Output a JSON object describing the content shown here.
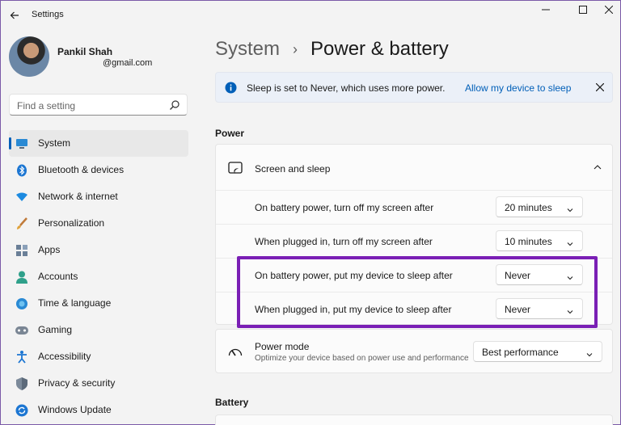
{
  "window": {
    "title": "Settings"
  },
  "user": {
    "name": "Pankil Shah",
    "email": "@gmail.com"
  },
  "search": {
    "placeholder": "Find a setting"
  },
  "sidebar": {
    "items": [
      {
        "label": "System",
        "icon": "monitor-icon"
      },
      {
        "label": "Bluetooth & devices",
        "icon": "bluetooth-icon"
      },
      {
        "label": "Network & internet",
        "icon": "wifi-icon"
      },
      {
        "label": "Personalization",
        "icon": "brush-icon"
      },
      {
        "label": "Apps",
        "icon": "apps-icon"
      },
      {
        "label": "Accounts",
        "icon": "person-icon"
      },
      {
        "label": "Time & language",
        "icon": "globe-clock-icon"
      },
      {
        "label": "Gaming",
        "icon": "gamepad-icon"
      },
      {
        "label": "Accessibility",
        "icon": "accessibility-icon"
      },
      {
        "label": "Privacy & security",
        "icon": "shield-icon"
      },
      {
        "label": "Windows Update",
        "icon": "update-icon"
      }
    ]
  },
  "breadcrumb": {
    "parent": "System",
    "separator": "›",
    "current": "Power & battery"
  },
  "banner": {
    "text": "Sleep is set to Never, which uses more power.",
    "link": "Allow my device to sleep"
  },
  "sections": {
    "power": "Power",
    "battery": "Battery"
  },
  "screen_sleep": {
    "title": "Screen and sleep",
    "rows": [
      {
        "label": "On battery power, turn off my screen after",
        "value": "20 minutes"
      },
      {
        "label": "When plugged in, turn off my screen after",
        "value": "10 minutes"
      },
      {
        "label": "On battery power, put my device to sleep after",
        "value": "Never"
      },
      {
        "label": "When plugged in, put my device to sleep after",
        "value": "Never"
      }
    ]
  },
  "power_mode": {
    "title": "Power mode",
    "subtitle": "Optimize your device based on power use and performance",
    "value": "Best performance"
  },
  "colors": {
    "accent": "#005fb8",
    "highlight": "#7a1fb5",
    "active_nav": "#e8e8e8"
  }
}
